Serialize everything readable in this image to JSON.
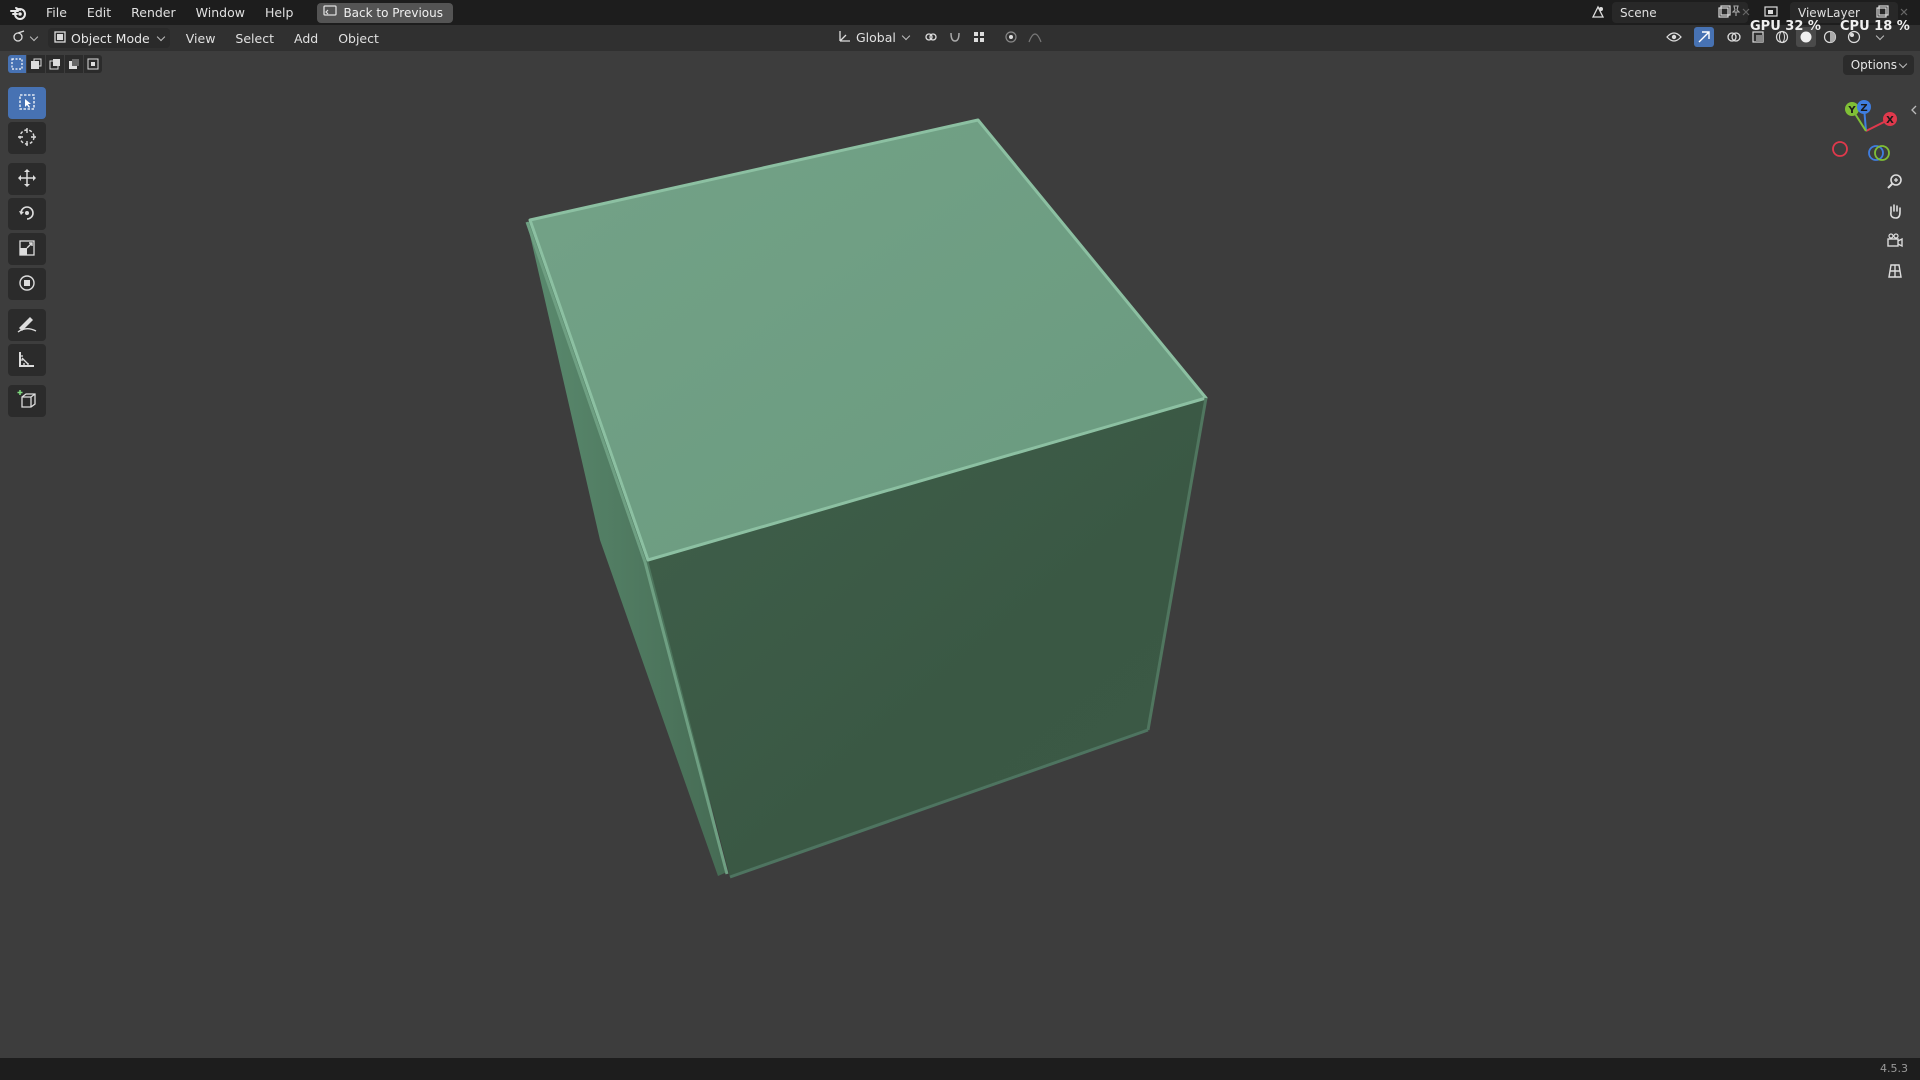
{
  "topbar": {
    "menu": [
      "File",
      "Edit",
      "Render",
      "Window",
      "Help"
    ],
    "back_label": "Back to Previous",
    "scene": "Scene",
    "view_layer": "ViewLayer",
    "gpu": "GPU 32 %",
    "cpu": "CPU 18 %"
  },
  "header": {
    "mode": "Object Mode",
    "menu": [
      "View",
      "Select",
      "Add",
      "Object"
    ],
    "transform_orientation": "Global"
  },
  "viewport": {
    "options_label": "Options",
    "object_color": "#6b9c82"
  },
  "gizmo": {
    "x_label": "X",
    "y_label": "Y",
    "z_label": "Z",
    "x_color": "#e0394c",
    "y_color": "#7fbf36",
    "z_color": "#3f7ee0"
  },
  "status": {
    "version": "4.5.3"
  }
}
